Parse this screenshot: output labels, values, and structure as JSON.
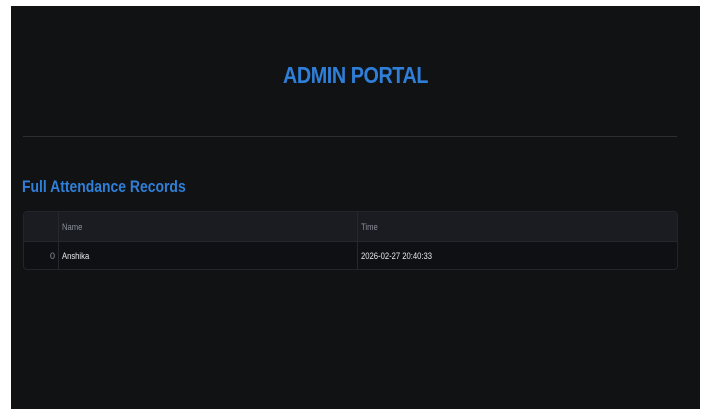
{
  "app": {
    "title": "ADMIN PORTAL"
  },
  "section": {
    "title": "Full Attendance Records"
  },
  "table": {
    "columns": [
      "Name",
      "Time"
    ],
    "rows": [
      {
        "index": "0",
        "name": "Anshika",
        "time": "2026-02-27 20:40:33"
      }
    ]
  },
  "colors": {
    "background": "#111214",
    "accent": "#2f7fd8",
    "header_bg": "#1a1c22",
    "border": "#23252b"
  }
}
